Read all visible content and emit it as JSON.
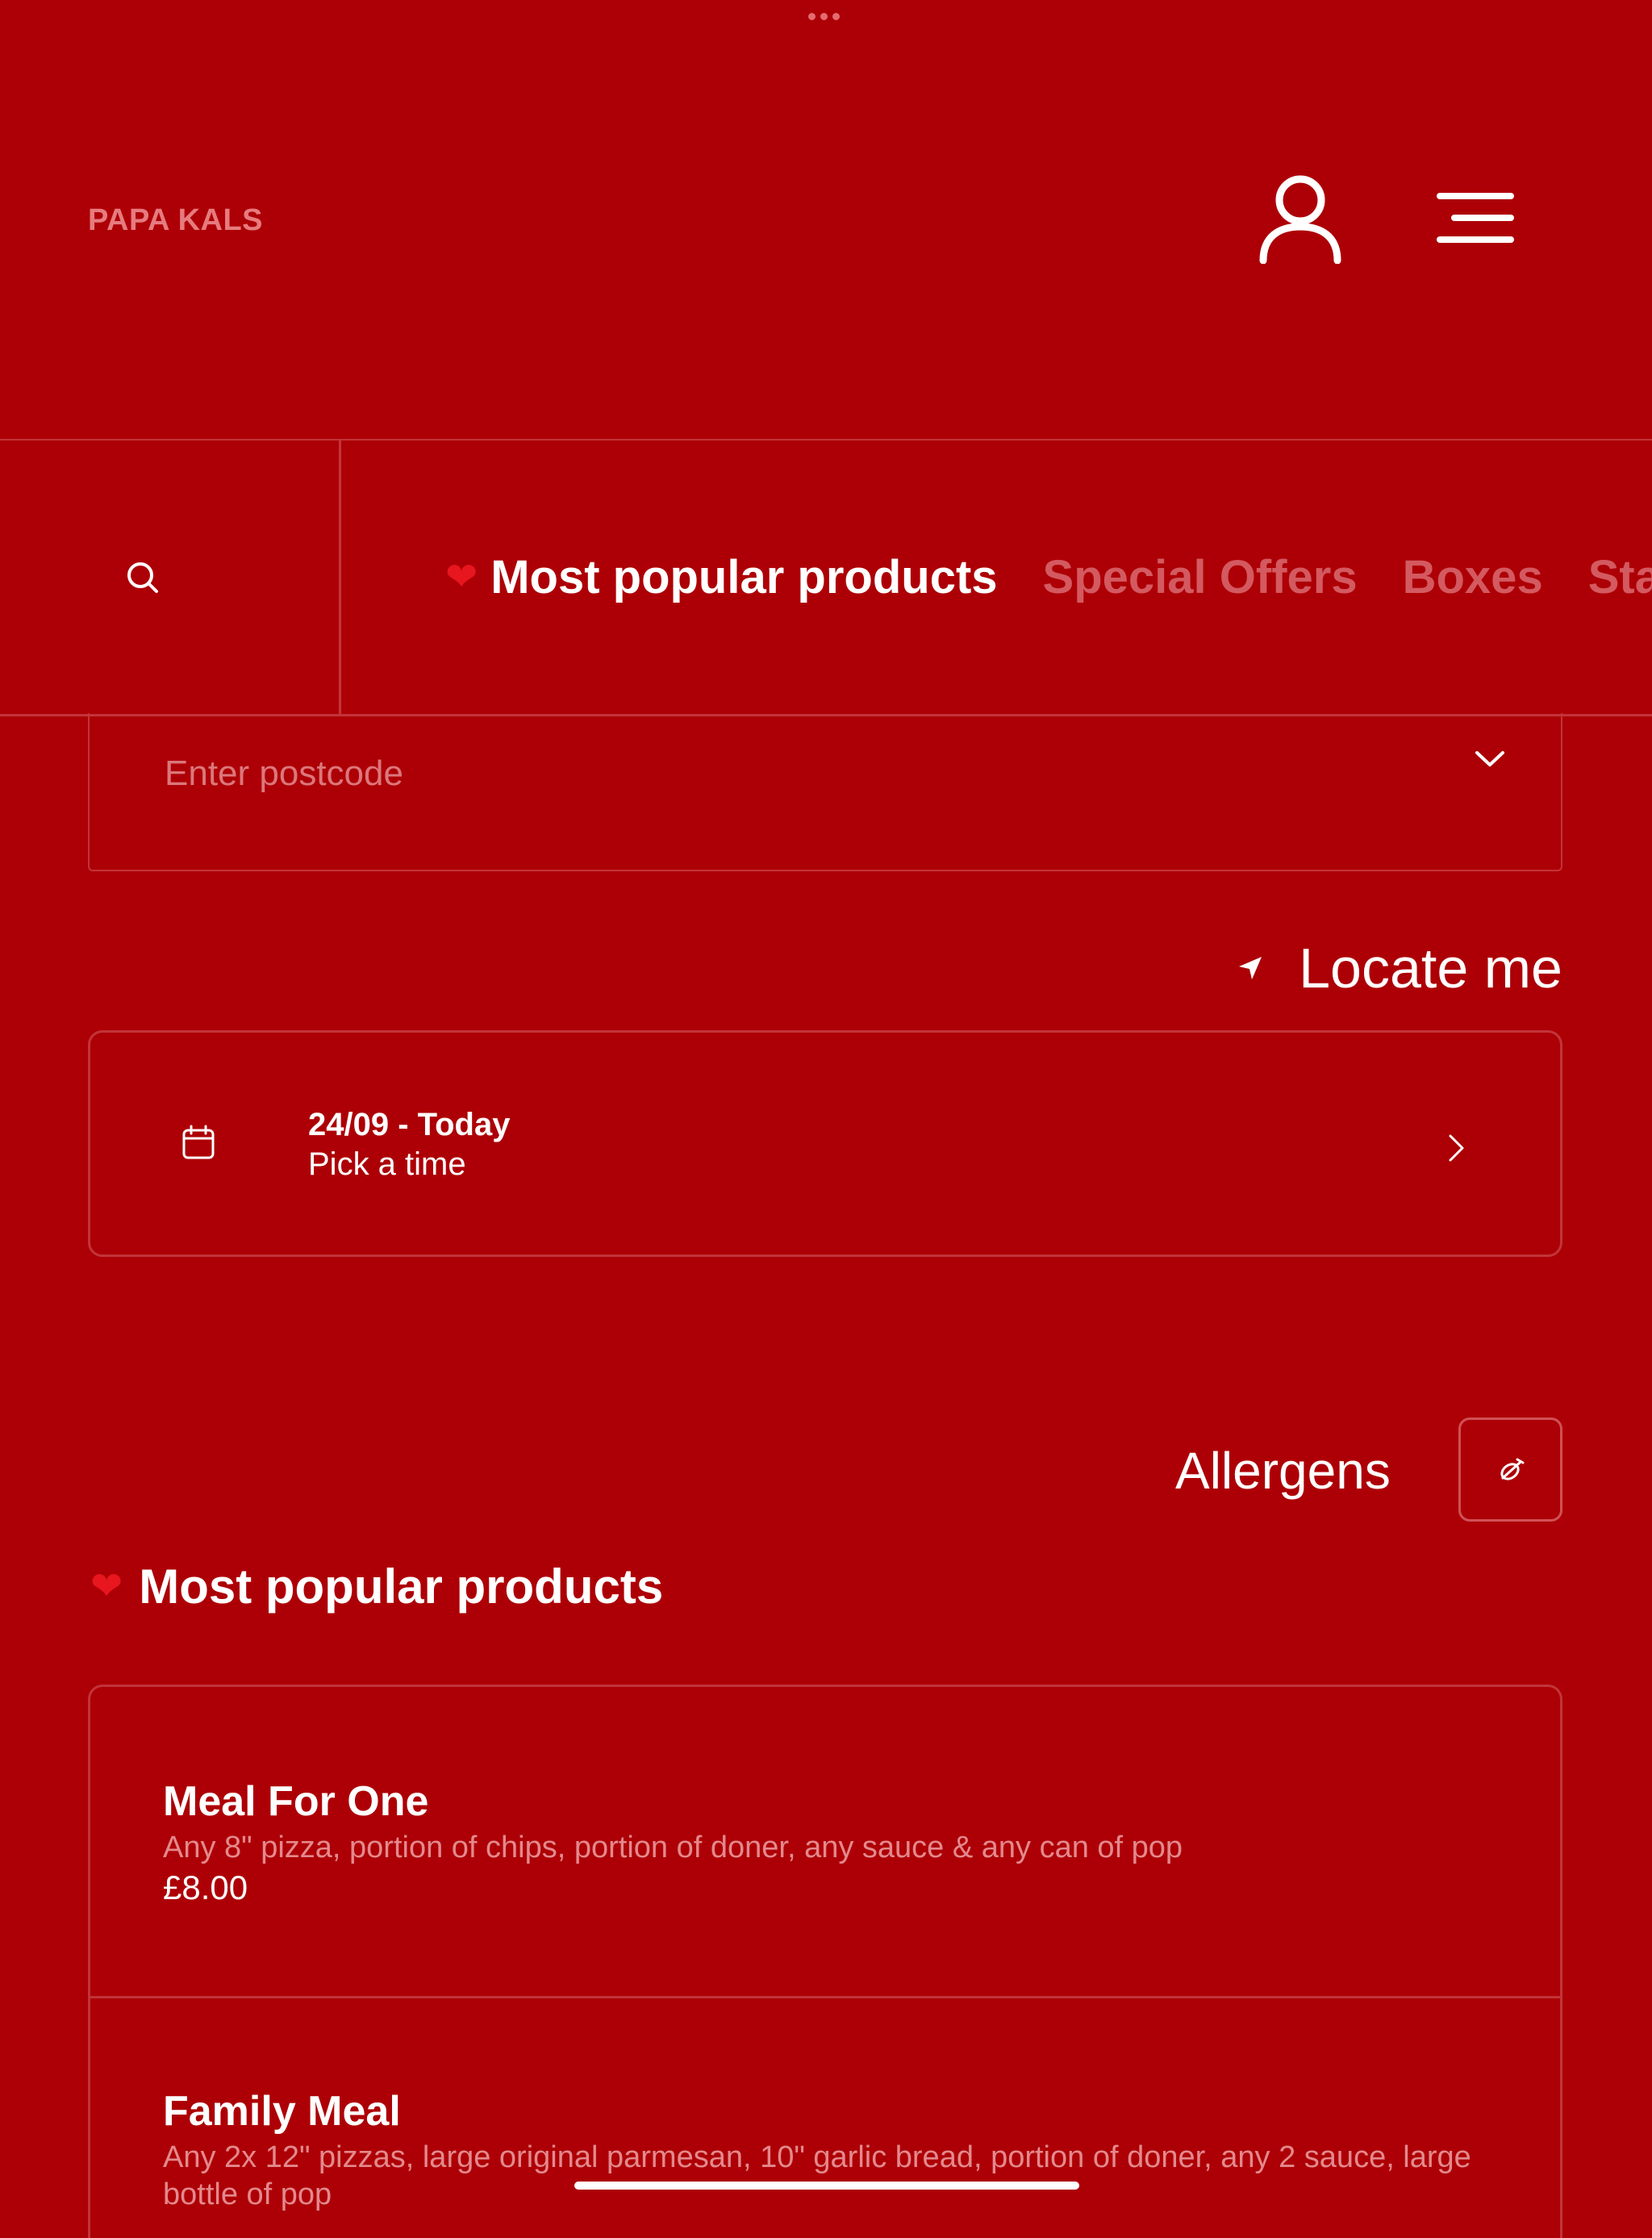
{
  "header": {
    "brand": "PAPA KALS"
  },
  "nav": {
    "tabs": [
      {
        "label": "Most popular products",
        "icon": "heart-icon",
        "active": true
      },
      {
        "label": "Special Offers"
      },
      {
        "label": "Boxes"
      },
      {
        "label": "Sta"
      }
    ]
  },
  "postcode": {
    "placeholder": "Enter postcode"
  },
  "locate": {
    "label": "Locate me"
  },
  "date": {
    "title": "24/09 - Today",
    "subtitle": "Pick a time"
  },
  "allergens": {
    "label": "Allergens"
  },
  "section": {
    "title": "Most popular products"
  },
  "products": [
    {
      "name": "Meal For One",
      "description": "Any 8\" pizza, portion of chips, portion of doner, any sauce & any can of pop",
      "price": "£8.00"
    },
    {
      "name": "Family Meal",
      "description": "Any 2x 12\" pizzas, large original parmesan, 10\" garlic bread, portion of doner, any 2 sauce, large bottle of pop"
    }
  ],
  "colors": {
    "background": "#ad0006",
    "border": "#c2343a",
    "muted_text": "#d35a60"
  }
}
